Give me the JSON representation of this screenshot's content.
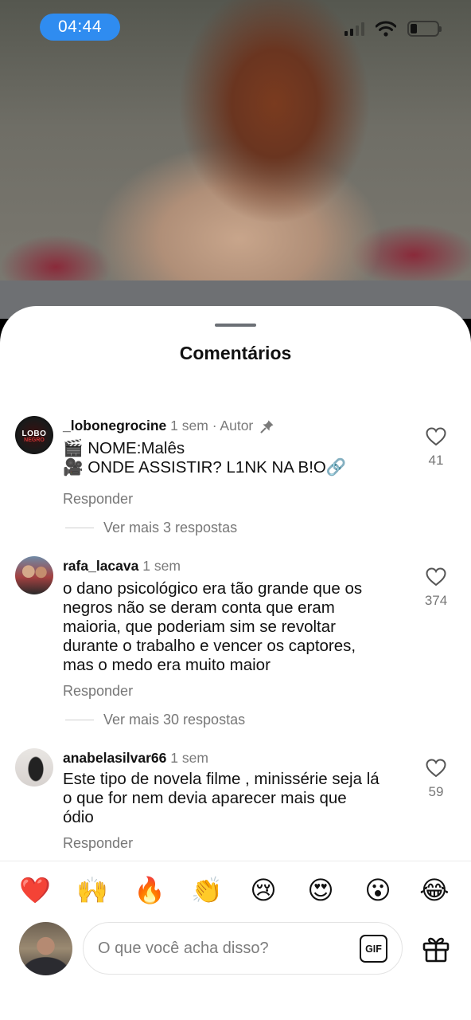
{
  "status_bar": {
    "time": "04:44"
  },
  "sheet": {
    "title": "Comentários"
  },
  "comments": [
    {
      "username": "_lobonegrocine",
      "time": "1 sem",
      "author_tag": "· Autor",
      "avatar_text": "LOBO",
      "avatar_subtext": "NEGRO",
      "lines": [
        "🎬 NOME:Malês",
        "🎥 ONDE ASSISTIR? L1NK NA B!O🔗"
      ],
      "reply_label": "Responder",
      "more_replies": "Ver mais 3 respostas",
      "likes": "41"
    },
    {
      "username": "rafa_lacava",
      "time": "1 sem",
      "lines": [
        "o dano psicológico era tão grande que os",
        "negros não se deram conta que eram",
        "maioria, que poderiam sim se revoltar",
        "durante o trabalho e vencer os captores,",
        "mas o medo era muito maior"
      ],
      "reply_label": "Responder",
      "more_replies": "Ver mais 30 respostas",
      "likes": "374"
    },
    {
      "username": "anabelasilvar66",
      "time": "1 sem",
      "lines": [
        "Este tipo de novela filme , minissérie seja lá",
        "o que for nem devia aparecer mais que",
        "ódio"
      ],
      "reply_label": "Responder",
      "likes": "59"
    }
  ],
  "reactions": [
    "❤️",
    "🙌",
    "🔥",
    "👏",
    "😢",
    "😍",
    "😮",
    "😂"
  ],
  "composer": {
    "placeholder": "O que você acha disso?",
    "gif_label": "GIF"
  },
  "icons": [
    "heart-icon",
    "pin-icon",
    "gif-icon",
    "gift-icon",
    "wifi-icon",
    "signal-icon",
    "battery-icon"
  ]
}
